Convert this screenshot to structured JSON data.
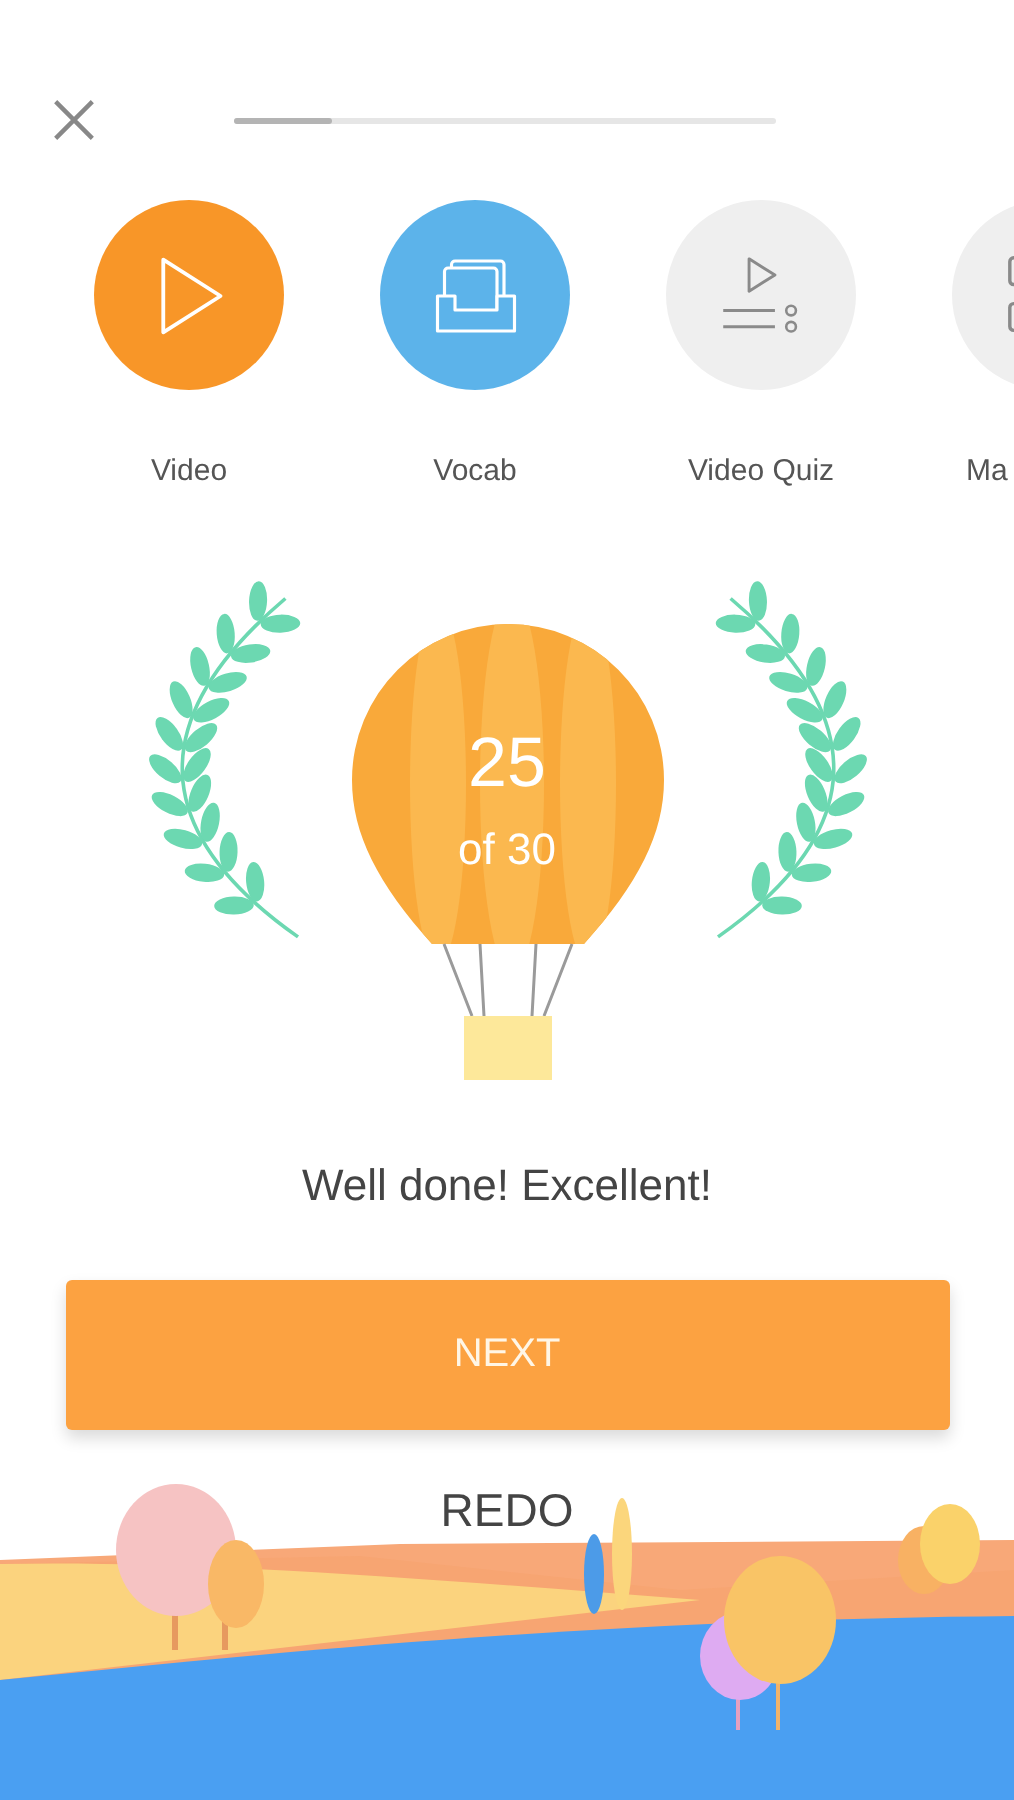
{
  "progress": {
    "level": 0.18
  },
  "steps": [
    {
      "label": "Video",
      "kind": "video",
      "completed": true,
      "color": "#f89628"
    },
    {
      "label": "Vocab",
      "kind": "vocab",
      "completed": true,
      "color": "#5cb3ea"
    },
    {
      "label": "Video Quiz",
      "kind": "quiz",
      "completed": false
    },
    {
      "label": "Ma",
      "kind": "match",
      "completed": false
    }
  ],
  "result": {
    "score": "25",
    "total": "of 30",
    "message": "Well done! Excellent!"
  },
  "next_button": {
    "label": "NEXT"
  },
  "redo_button": {
    "label": "REDO"
  }
}
